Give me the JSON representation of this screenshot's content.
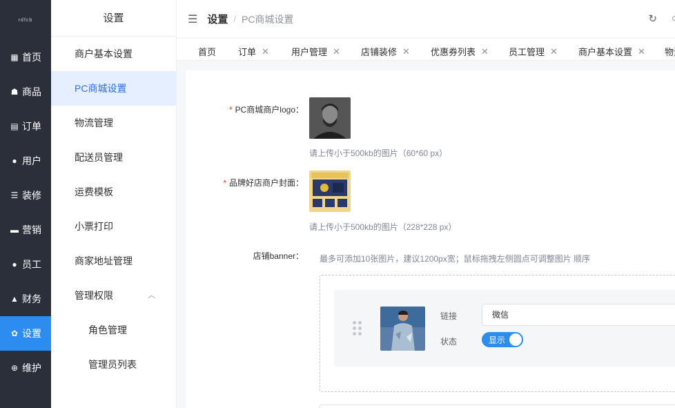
{
  "app": {
    "logo_text": "rdfcb"
  },
  "rail": {
    "items": [
      {
        "label": "首页",
        "icon": "grid-icon"
      },
      {
        "label": "商品",
        "icon": "bag-icon"
      },
      {
        "label": "订单",
        "icon": "doc-icon"
      },
      {
        "label": "用户",
        "icon": "user-icon"
      },
      {
        "label": "装修",
        "icon": "sliders-icon"
      },
      {
        "label": "营销",
        "icon": "chat-icon"
      },
      {
        "label": "员工",
        "icon": "person-icon"
      },
      {
        "label": "财务",
        "icon": "thumb-icon"
      },
      {
        "label": "设置",
        "icon": "gear-icon"
      },
      {
        "label": "维护",
        "icon": "plus-circle-icon"
      }
    ],
    "active_index": 8
  },
  "submenu": {
    "title": "设置",
    "items": [
      "商户基本设置",
      "PC商城设置",
      "物流管理",
      "配送员管理",
      "运费模板",
      "小票打印",
      "商家地址管理",
      "管理权限",
      "角色管理",
      "管理员列表"
    ]
  },
  "header": {
    "crumb_root": "设置",
    "crumb_sep": "/",
    "crumb_current": "PC商城设置"
  },
  "tabs": [
    "首页",
    "订单",
    "用户管理",
    "店铺装修",
    "优惠券列表",
    "员工管理",
    "商户基本设置",
    "物流"
  ],
  "form": {
    "logo_label": "PC商城商户logo：",
    "logo_hint": "请上传小于500kb的图片（60*60 px）",
    "cover_label": "品牌好店商户封面：",
    "cover_hint": "请上传小于500kb的图片（228*228 px）",
    "banner_label": "店铺banner：",
    "banner_hint": "最多可添加10张图片，建议1200px宽；鼠标拖拽左侧圆点可调整图片 顺序",
    "required_mark": "*"
  },
  "banner_item": {
    "link_label": "链接",
    "link_value": "微信",
    "status_label": "状态",
    "status_text": "显示",
    "status_on": true
  },
  "colors": {
    "accent": "#2d8cf0",
    "rail_bg": "#2b2f3a",
    "required": "#ed4014"
  }
}
